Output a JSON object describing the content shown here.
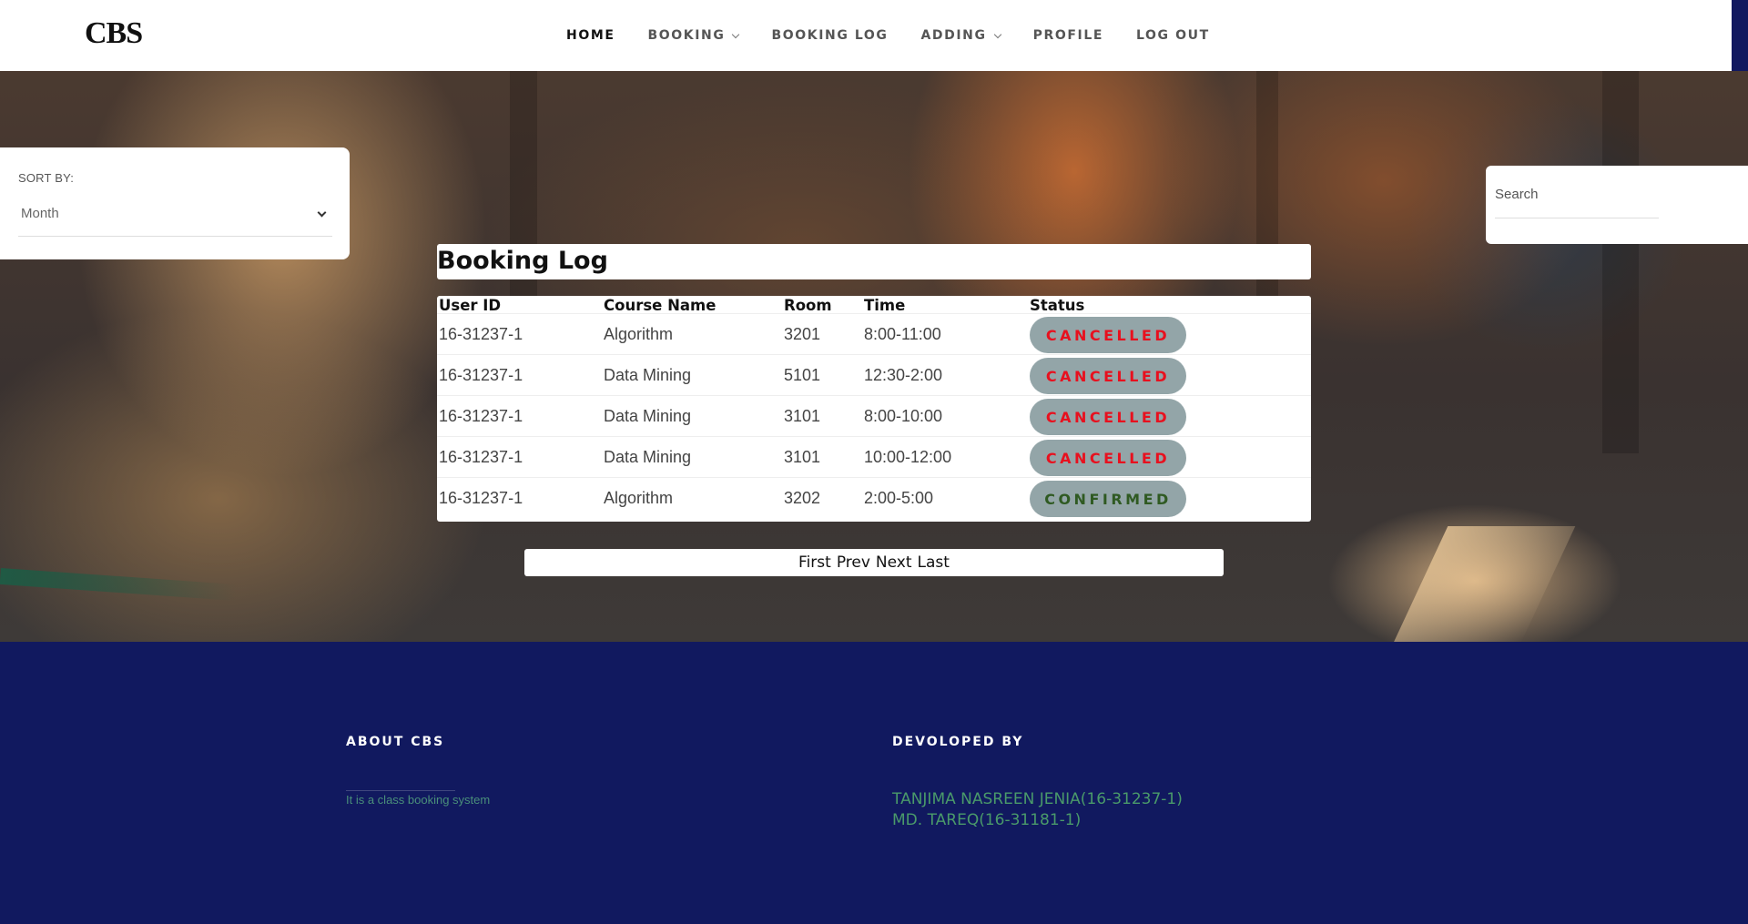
{
  "nav": {
    "brand": "CBS",
    "items": [
      {
        "label": "HOME",
        "active": true,
        "dropdown": false
      },
      {
        "label": "BOOKING",
        "active": false,
        "dropdown": true
      },
      {
        "label": "BOOKING LOG",
        "active": false,
        "dropdown": false
      },
      {
        "label": "ADDING",
        "active": false,
        "dropdown": true
      },
      {
        "label": "PROFILE",
        "active": false,
        "dropdown": false
      },
      {
        "label": "LOG OUT",
        "active": false,
        "dropdown": false
      }
    ]
  },
  "sort": {
    "label": "SORT BY:",
    "selected": "Month",
    "icon": "chevron-down-icon"
  },
  "search": {
    "placeholder": "Search",
    "value": ""
  },
  "booking_log": {
    "title": "Booking Log",
    "columns": [
      "User ID",
      "Course Name",
      "Room",
      "Time",
      "Status"
    ],
    "rows": [
      {
        "user_id": "16-31237-1",
        "course": "Algorithm",
        "room": "3201",
        "time": "8:00-11:00",
        "status": "CANCELLED"
      },
      {
        "user_id": "16-31237-1",
        "course": "Data Mining",
        "room": "5101",
        "time": "12:30-2:00",
        "status": "CANCELLED"
      },
      {
        "user_id": "16-31237-1",
        "course": "Data Mining",
        "room": "3101",
        "time": "8:00-10:00",
        "status": "CANCELLED"
      },
      {
        "user_id": "16-31237-1",
        "course": "Data Mining",
        "room": "3101",
        "time": "10:00-12:00",
        "status": "CANCELLED"
      },
      {
        "user_id": "16-31237-1",
        "course": "Algorithm",
        "room": "3202",
        "time": "2:00-5:00",
        "status": "CONFIRMED"
      }
    ],
    "status_colors": {
      "CANCELLED": "#e8101e",
      "CONFIRMED": "#2f5a22"
    }
  },
  "pagination": {
    "first": "First",
    "prev": "Prev",
    "next": "Next",
    "last": "Last"
  },
  "footer": {
    "about_heading": "ABOUT CBS",
    "about_text": "It is a class booking system",
    "dev_heading": "DEVOLOPED BY",
    "developers": [
      "TANJIMA NASREEN JENIA(16-31237-1)",
      "MD. TAREQ(16-31181-1)"
    ]
  },
  "colors": {
    "footer_bg": "#11195f",
    "pill_bg": "#93a5a8",
    "footer_text": "#4a9a6a"
  }
}
